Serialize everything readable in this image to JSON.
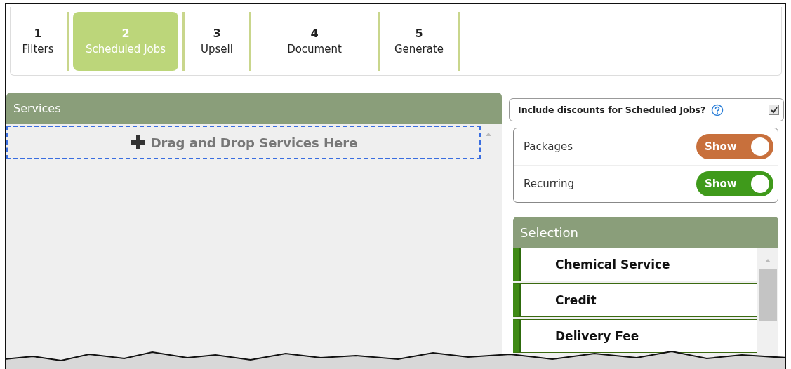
{
  "steps": [
    {
      "number": "1",
      "label": "Filters",
      "selected": false
    },
    {
      "number": "2",
      "label": "Scheduled Jobs",
      "selected": true
    },
    {
      "number": "3",
      "label": "Upsell",
      "selected": false
    },
    {
      "number": "4",
      "label": "Document",
      "selected": false
    },
    {
      "number": "5",
      "label": "Generate",
      "selected": false
    }
  ],
  "services": {
    "title": "Services",
    "drop_zone": "Drag and Drop Services Here"
  },
  "discounts": {
    "label": "Include discounts for Scheduled Jobs?",
    "checked": true
  },
  "toggles": [
    {
      "label": "Packages",
      "text": "Show",
      "on": true,
      "color": "#c8703c"
    },
    {
      "label": "Recurring",
      "text": "Show",
      "on": true,
      "color": "#3f9a1b"
    }
  ],
  "selection": {
    "title": "Selection",
    "items": [
      "Chemical Service",
      "Credit",
      "Delivery Fee"
    ]
  }
}
